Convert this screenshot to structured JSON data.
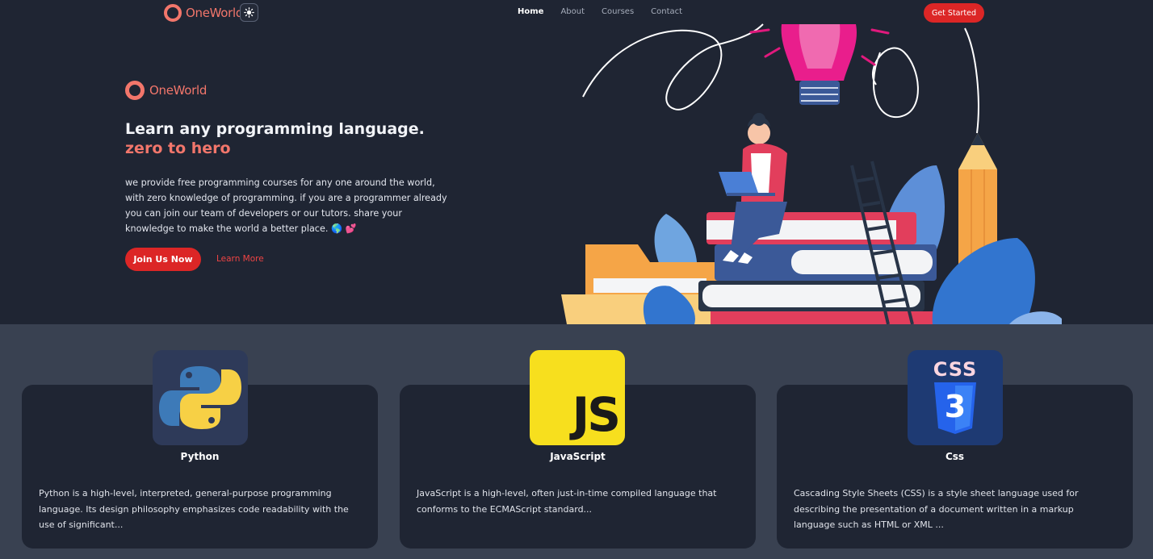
{
  "nav": {
    "brand": "OneWorld",
    "theme_icon": "sun-icon",
    "links": [
      "Home",
      "About",
      "Courses",
      "Contact"
    ],
    "active_link": "Home",
    "cta": "Get Started"
  },
  "hero": {
    "brand": "OneWorld",
    "headline": "Learn any programming language.",
    "headline_accent": "zero to hero",
    "description": "we provide free programming courses for any one around the world, with zero knowledge of programming. if you are a programmer already you can join our team of developers or our tutors. share your knowledge to make the world a better place. 🌎 💕",
    "primary_button": "Join Us Now",
    "secondary_link": "Learn More"
  },
  "courses": [
    {
      "title": "Python",
      "icon": "python-logo",
      "description": "Python is a high-level, interpreted, general-purpose programming language. Its design philosophy emphasizes code readability with the use of significant..."
    },
    {
      "title": "JavaScript",
      "icon": "javascript-logo",
      "icon_text": "JS",
      "description": "JavaScript is a high-level, often just-in-time compiled language that conforms to the ECMAScript standard..."
    },
    {
      "title": "Css",
      "icon": "css-logo",
      "icon_text": "CSS",
      "shield_text": "3",
      "description": "Cascading Style Sheets (CSS) is a style sheet language used for describing the presentation of a document written in a markup language such as HTML or XML ..."
    }
  ],
  "colors": {
    "background": "#1f2533",
    "section": "#394151",
    "accent": "#f2766b",
    "button": "#dc2626"
  }
}
